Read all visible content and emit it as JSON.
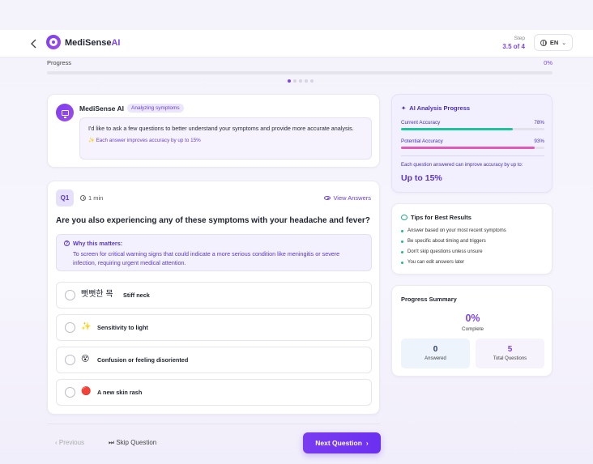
{
  "header": {
    "brand_a": "MediSense",
    "brand_b": "AI",
    "step_label": "Step",
    "step_value": "3.5 of 4",
    "language": "EN"
  },
  "progress": {
    "label": "Progress",
    "percent_text": "0%",
    "value": 0,
    "dots_total": 5,
    "dots_active": 1
  },
  "intro": {
    "ai_name": "MediSense AI",
    "badge": "Analyzing symptoms",
    "message": "I'd like to ask a few questions to better understand your symptoms and provide more accurate analysis.",
    "tip": "✨ Each answer improves accuracy by up to 15%"
  },
  "question": {
    "number": "Q1",
    "time": "1 min",
    "view_answers": "View Answers",
    "text": "Are you also experiencing any of these symptoms with your headache and fever?",
    "why_title": "Why this matters:",
    "why_text": "To screen for critical warning signs that could indicate a more serious condition like meningitis or severe infection, requiring urgent medical attention.",
    "options": [
      {
        "emoji": "뻣뻣한 목",
        "label": "Stiff neck"
      },
      {
        "emoji": "✨",
        "label": "Sensitivity to light"
      },
      {
        "emoji": "😵",
        "label": "Confusion or feeling disoriented"
      },
      {
        "emoji": "🔴",
        "label": "A new skin rash"
      }
    ]
  },
  "footer": {
    "previous": "‹ Previous",
    "skip": "⏭ Skip Question",
    "next": "Next Question"
  },
  "ai_progress": {
    "title": "AI Analysis Progress",
    "current_label": "Current Accuracy",
    "current_text": "78%",
    "current_value": 78,
    "potential_label": "Potential Accuracy",
    "potential_text": "93%",
    "potential_value": 93,
    "note": "Each question answered can improve accuracy by up to:",
    "big": "Up to 15%",
    "colors": {
      "current": "#1fc39b",
      "potential": "#e05ab8"
    }
  },
  "tips": {
    "title": "Tips for Best Results",
    "items": [
      "Answer based on your most recent symptoms",
      "Be specific about timing and triggers",
      "Don't skip questions unless unsure",
      "You can edit answers later"
    ]
  },
  "summary": {
    "title": "Progress Summary",
    "percent": "0%",
    "complete_label": "Complete",
    "answered_value": "0",
    "answered_label": "Answered",
    "total_value": "5",
    "total_label": "Total Questions"
  }
}
